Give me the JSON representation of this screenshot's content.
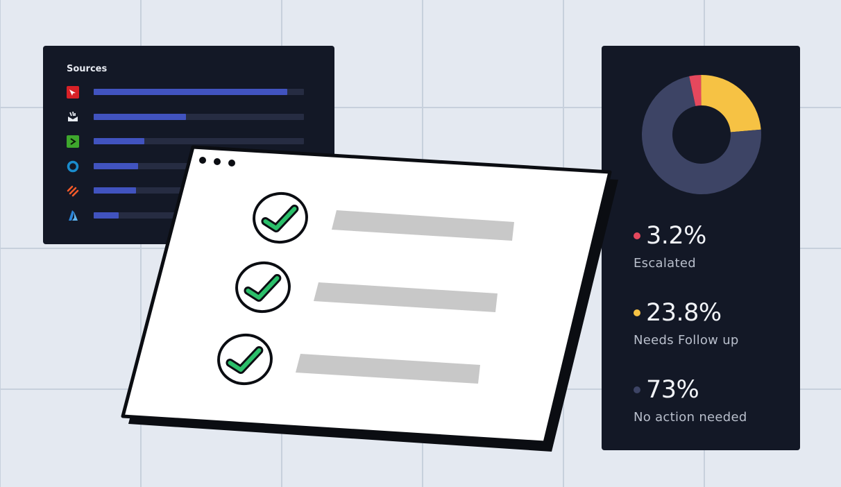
{
  "sources": {
    "title": "Sources",
    "items": [
      {
        "icon": "red-arrow-logo-icon",
        "fill": 0.92,
        "color": "#d82127"
      },
      {
        "icon": "stack-logo-icon",
        "fill": 0.44,
        "color": "#e8ecf3"
      },
      {
        "icon": "terminal-logo-icon",
        "fill": 0.24,
        "color": "#3ea72d"
      },
      {
        "icon": "ring-logo-icon",
        "fill": 0.21,
        "color": "#1a8ccd"
      },
      {
        "icon": "slashes-logo-icon",
        "fill": 0.2,
        "color": "#f25a2a"
      },
      {
        "icon": "azure-logo-icon",
        "fill": 0.12,
        "color": "#2a84d8"
      }
    ]
  },
  "checklist": {
    "items": [
      {
        "icon": "check-icon",
        "checked": true
      },
      {
        "icon": "check-icon",
        "checked": true
      },
      {
        "icon": "check-icon",
        "checked": true
      }
    ]
  },
  "results": {
    "stats": [
      {
        "value": "3.2%",
        "label": "Escalated",
        "color": "#e5485d"
      },
      {
        "value": "23.8%",
        "label": "Needs Follow up",
        "color": "#f6c244"
      },
      {
        "value": "73%",
        "label": "No action needed",
        "color": "#3d4465"
      }
    ]
  },
  "chart_data": {
    "type": "pie",
    "categories": [
      "Escalated",
      "Needs Follow up",
      "No action needed"
    ],
    "values": [
      3.2,
      23.8,
      73
    ],
    "colors": [
      "#e5485d",
      "#f6c244",
      "#3d4465"
    ]
  }
}
